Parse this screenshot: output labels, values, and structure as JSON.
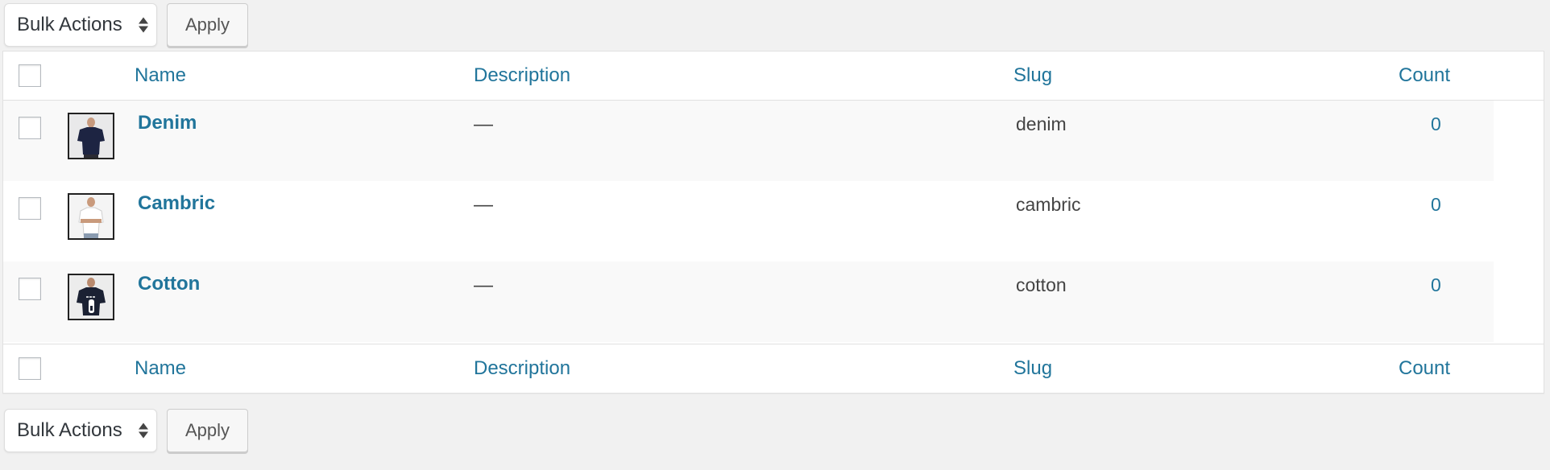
{
  "bulk_actions": {
    "top": {
      "select_value": "Bulk Actions",
      "apply_label": "Apply"
    },
    "bottom": {
      "select_value": "Bulk Actions",
      "apply_label": "Apply"
    }
  },
  "table": {
    "columns": {
      "name": "Name",
      "description": "Description",
      "slug": "Slug",
      "count": "Count"
    },
    "rows": [
      {
        "name": "Denim",
        "description": "—",
        "slug": "denim",
        "count": "0",
        "thumbnail": "dark-tshirt-icon"
      },
      {
        "name": "Cambric",
        "description": "—",
        "slug": "cambric",
        "count": "0",
        "thumbnail": "white-tshirt-icon"
      },
      {
        "name": "Cotton",
        "description": "—",
        "slug": "cotton",
        "count": "0",
        "thumbnail": "number-tshirt-icon"
      }
    ]
  },
  "colors": {
    "link": "#21759b",
    "background": "#f1f1f1",
    "alt_row": "#f9f9f9"
  }
}
